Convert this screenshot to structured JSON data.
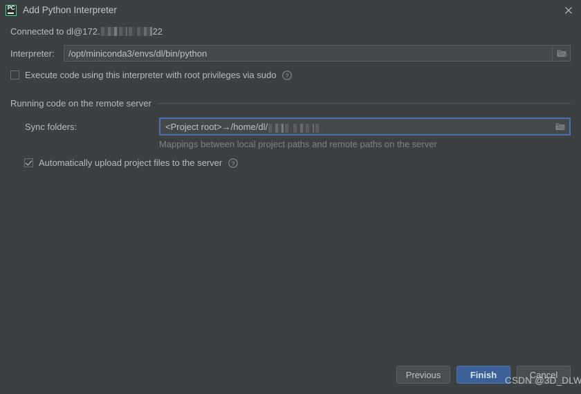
{
  "window": {
    "title": "Add Python Interpreter",
    "app_icon": "pycharm-icon",
    "icon_text": "PC",
    "close_icon": "close-icon",
    "accent_color": "#3c6199",
    "focus_border_color": "#4b6eaf",
    "background_color": "#3c4043",
    "icon_border_color": "#3ddb85"
  },
  "connection": {
    "prefix": "Connected to dl@172.",
    "suffix": "22"
  },
  "interpreter": {
    "label": "Interpreter:",
    "value": "/opt/miniconda3/envs/dl/bin/python",
    "browse_icon": "folder-icon"
  },
  "sudo": {
    "label": "Execute code using this interpreter with root privileges via sudo",
    "checked": false,
    "help_icon": "help-circle-icon"
  },
  "remote_section": {
    "title": "Running code on the remote server"
  },
  "sync_folders": {
    "label": "Sync folders:",
    "value": "<Project root>→/home/dl/",
    "hint": "Mappings between local project paths and remote paths on the server",
    "browse_icon": "folder-icon"
  },
  "auto_upload": {
    "label": "Automatically upload project files to the server",
    "checked": true,
    "help_icon": "help-circle-icon"
  },
  "footer": {
    "previous_label": "Previous",
    "finish_label": "Finish",
    "cancel_label": "Cancel"
  },
  "watermark": {
    "text": "CSDN @3D_DLW"
  }
}
